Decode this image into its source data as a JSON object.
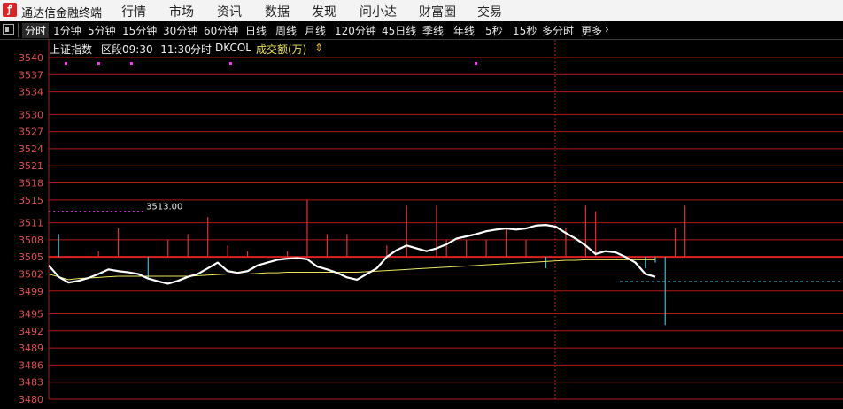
{
  "app": {
    "title": "通达信金融终端",
    "logo_glyph": "ꝭ"
  },
  "menu": [
    "行情",
    "市场",
    "资讯",
    "数据",
    "发现",
    "问小达",
    "财富圈",
    "交易"
  ],
  "period_tabs": [
    "分时",
    "1分钟",
    "5分钟",
    "15分钟",
    "30分钟",
    "60分钟",
    "日线",
    "周线",
    "月线",
    "120分钟",
    "45日线",
    "季线",
    "年线",
    "5秒",
    "15秒",
    "多分时",
    "更多"
  ],
  "active_tab": "分时",
  "more_chevron": "›",
  "chart_header": {
    "index_name": "上证指数",
    "range": "区段09:30--11:30",
    "mode": "分时",
    "indicator": "DKCOL",
    "indicator_sub": "成交额(万)",
    "sort_arrows": "⇕"
  },
  "price_marker_label": "3513.00",
  "colors": {
    "grid": "#b01818",
    "axis_text": "#e05050",
    "price_line": "#ffffff",
    "avg_line": "#e8e860",
    "up_bar": "#e03030",
    "down_bar": "#30c0d0",
    "flat_bar": "#30c040",
    "marker": "#ff30ff"
  },
  "chart_data": {
    "type": "line",
    "y_ticks": [
      3540,
      3537,
      3534,
      3530,
      3527,
      3524,
      3521,
      3518,
      3515,
      3511,
      3508,
      3505,
      3502,
      3499,
      3495,
      3492,
      3489,
      3486,
      3483,
      3480
    ],
    "ylim": [
      3480,
      3540
    ],
    "xlim": [
      0,
      120
    ],
    "series": [
      {
        "values": [
          3503.5,
          3501.5,
          3500.5,
          3500.8,
          3501.3,
          3502.0,
          3502.8,
          3502.5,
          3502.3,
          3502.0,
          3501.2,
          3500.7,
          3500.3,
          3500.8,
          3501.5,
          3502.0,
          3503.0,
          3504.0,
          3502.5,
          3502.2,
          3502.5,
          3503.5,
          3504.0,
          3504.5,
          3504.7,
          3504.8,
          3504.6,
          3503.3,
          3502.8,
          3502.2,
          3501.4,
          3501.0,
          3502.0,
          3503.0,
          3505.0,
          3506.2,
          3507.0,
          3506.5,
          3506.0,
          3506.5,
          3507.2,
          3508.2,
          3508.6,
          3509.0,
          3509.5,
          3509.8,
          3510.0,
          3509.8,
          3510.0,
          3510.5,
          3510.6,
          3510.3,
          3509.2,
          3508.2,
          3507.0,
          3505.5,
          3506.0,
          3505.8,
          3505.0,
          3504.0,
          3502.0,
          3501.5
        ]
      },
      {
        "values": [
          3502.0,
          3501.5,
          3501.0,
          3501.2,
          3501.3,
          3501.4,
          3501.5,
          3501.6,
          3501.6,
          3501.6,
          3501.6,
          3501.6,
          3501.6,
          3501.6,
          3501.6,
          3501.7,
          3501.8,
          3501.9,
          3502.0,
          3502.0,
          3502.0,
          3502.1,
          3502.2,
          3502.2,
          3502.3,
          3502.3,
          3502.3,
          3502.3,
          3502.3,
          3502.3,
          3502.3,
          3502.3,
          3502.4,
          3502.5,
          3502.6,
          3502.7,
          3502.8,
          3502.9,
          3503.0,
          3503.1,
          3503.2,
          3503.3,
          3503.4,
          3503.5,
          3503.6,
          3503.7,
          3503.8,
          3503.9,
          3504.0,
          3504.1,
          3504.2,
          3504.3,
          3504.4,
          3504.4,
          3504.5,
          3504.5,
          3504.5,
          3504.5,
          3504.5,
          3504.5,
          3504.5,
          3504.5
        ]
      }
    ],
    "bars": {
      "indices": [
        1,
        5,
        7,
        9,
        10,
        12,
        14,
        16,
        18,
        20,
        24,
        26,
        28,
        30,
        32,
        34,
        36,
        39,
        40,
        42,
        44,
        46,
        48,
        50,
        52,
        54,
        55,
        60,
        61,
        62,
        63,
        64
      ],
      "values": [
        3509,
        3506,
        3510,
        3505,
        3501,
        3508,
        3509,
        3512,
        3507,
        3506,
        3506,
        3515,
        3509,
        3509,
        3505,
        3507,
        3514,
        3514,
        3508,
        3508,
        3508,
        3510,
        3508,
        3503,
        3510,
        3514,
        3513,
        3503,
        3504,
        3493,
        3510,
        3514
      ],
      "colors": [
        "down",
        "up",
        "up",
        "down",
        "down",
        "up",
        "up",
        "up",
        "up",
        "up",
        "up",
        "up",
        "up",
        "up",
        "down",
        "up",
        "up",
        "up",
        "up",
        "up",
        "up",
        "up",
        "up",
        "down",
        "up",
        "up",
        "up",
        "down",
        "down",
        "down",
        "up",
        "up"
      ]
    },
    "reference_price": 3505
  }
}
